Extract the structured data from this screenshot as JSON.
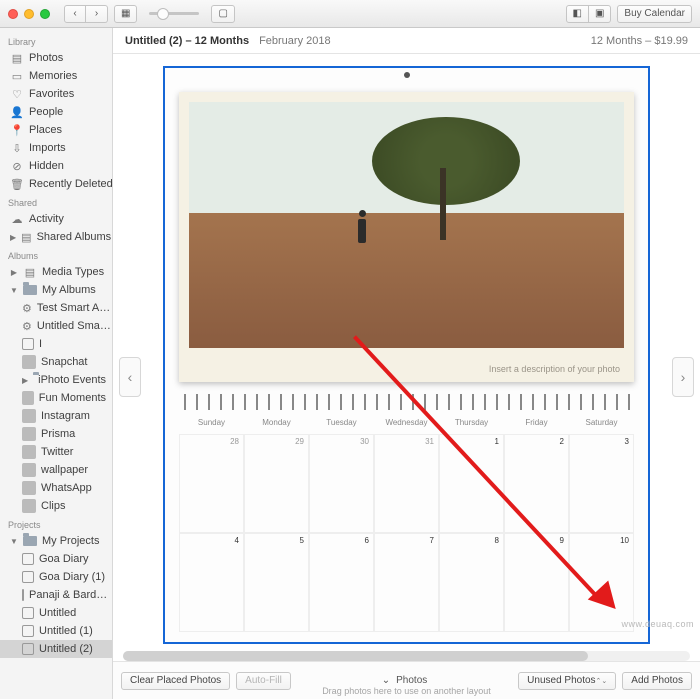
{
  "titlebar": {
    "buy_label": "Buy Calendar"
  },
  "sidebar": {
    "sections": {
      "library": "Library",
      "shared": "Shared",
      "albums": "Albums",
      "projects": "Projects"
    },
    "library": {
      "photos": "Photos",
      "memories": "Memories",
      "favorites": "Favorites",
      "people": "People",
      "places": "Places",
      "imports": "Imports",
      "hidden": "Hidden",
      "recently_deleted": "Recently Deleted"
    },
    "shared": {
      "activity": "Activity",
      "shared_albums": "Shared Albums"
    },
    "albums": {
      "media_types": "Media Types",
      "my_albums": "My Albums",
      "items": {
        "test_smart": "Test Smart A…",
        "untitled_sma": "Untitled Sma…",
        "i": "I",
        "snapchat": "Snapchat",
        "iphoto_events": "iPhoto Events",
        "fun_moments": "Fun Moments",
        "instagram": "Instagram",
        "prisma": "Prisma",
        "twitter": "Twitter",
        "wallpaper": "wallpaper",
        "whatsapp": "WhatsApp",
        "clips": "Clips"
      }
    },
    "projects": {
      "my_projects": "My Projects",
      "items": {
        "goa_diary": "Goa Diary",
        "goa_diary1": "Goa Diary (1)",
        "panaji": "Panaji & Bard…",
        "untitled": "Untitled",
        "untitled1": "Untitled (1)",
        "untitled2": "Untitled (2)"
      }
    }
  },
  "header": {
    "title": "Untitled (2) – 12 Months",
    "subtitle": "February 2018",
    "right": "12 Months – $19.99"
  },
  "calendar": {
    "caption": "Insert a description of your photo",
    "days": [
      "Sunday",
      "Monday",
      "Tuesday",
      "Wednesday",
      "Thursday",
      "Friday",
      "Saturday"
    ],
    "row1": [
      "28",
      "29",
      "30",
      "31",
      "1",
      "2",
      "3"
    ],
    "row2": [
      "4",
      "5",
      "6",
      "7",
      "8",
      "9",
      "10"
    ]
  },
  "toolbar": {
    "clear": "Clear Placed Photos",
    "autofill": "Auto-Fill",
    "photos": "Photos",
    "unused": "Unused Photos",
    "add": "Add Photos"
  },
  "footer_hint": "Drag photos here to use on another layout",
  "watermark": "www.deuaq.com"
}
